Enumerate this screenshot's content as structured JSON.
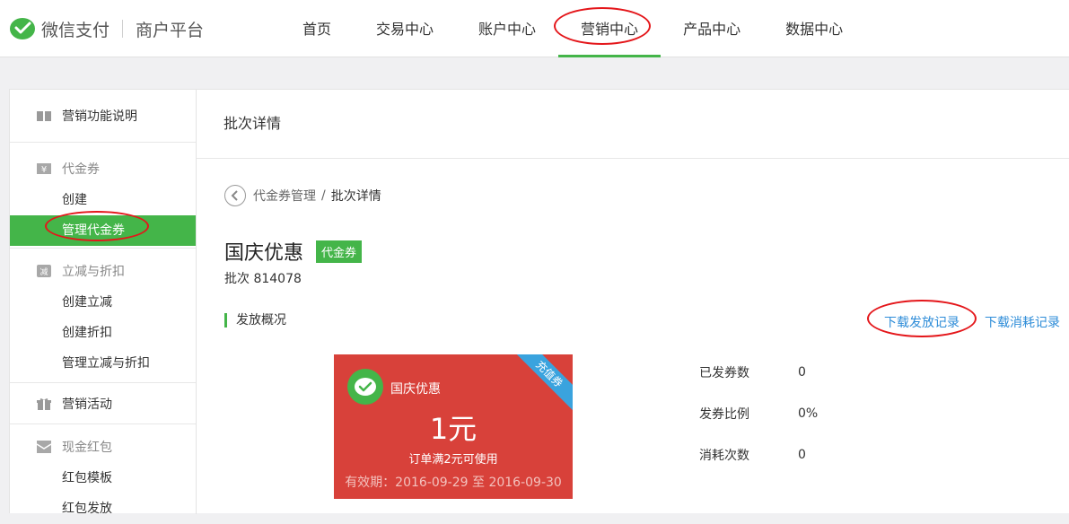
{
  "brand": {
    "name": "微信支付",
    "sub": "商户平台",
    "color": "#44b549"
  },
  "nav": {
    "items": [
      {
        "label": "首页"
      },
      {
        "label": "交易中心"
      },
      {
        "label": "账户中心"
      },
      {
        "label": "营销中心",
        "active": true
      },
      {
        "label": "产品中心"
      },
      {
        "label": "数据中心"
      }
    ]
  },
  "sidebar": {
    "intro": {
      "label": "营销功能说明",
      "icon": "book-icon"
    },
    "voucher": {
      "label": "代金券",
      "icon": "yen-icon",
      "items": [
        {
          "label": "创建"
        },
        {
          "label": "管理代金券",
          "active": true
        }
      ]
    },
    "discount": {
      "label": "立减与折扣",
      "icon": "discount-icon",
      "items": [
        {
          "label": "创建立减"
        },
        {
          "label": "创建折扣"
        },
        {
          "label": "管理立减与折扣"
        }
      ]
    },
    "activity": {
      "label": "营销活动",
      "icon": "gift-icon"
    },
    "redpacket": {
      "label": "现金红包",
      "icon": "redpacket-icon",
      "items": [
        {
          "label": "红包模板"
        },
        {
          "label": "红包发放"
        }
      ]
    }
  },
  "main": {
    "header": "批次详情",
    "breadcrumb": {
      "parent": "代金券管理",
      "sep": "/",
      "current": "批次详情"
    },
    "title": "国庆优惠",
    "tag": "代金券",
    "batch": "批次 814078",
    "section": "发放概况",
    "links": {
      "download_issue": "下载发放记录",
      "download_consume": "下载消耗记录"
    },
    "coupon": {
      "name": "国庆优惠",
      "amount": "1元",
      "condition": "订单满2元可使用",
      "validity": "有效期：2016-09-29 至 2016-09-30",
      "ribbon": "充值券",
      "bg_color": "#d8413a"
    },
    "stats": [
      {
        "label": "已发券数",
        "value": "0"
      },
      {
        "label": "发券比例",
        "value": "0%"
      },
      {
        "label": "消耗次数",
        "value": "0"
      }
    ]
  }
}
